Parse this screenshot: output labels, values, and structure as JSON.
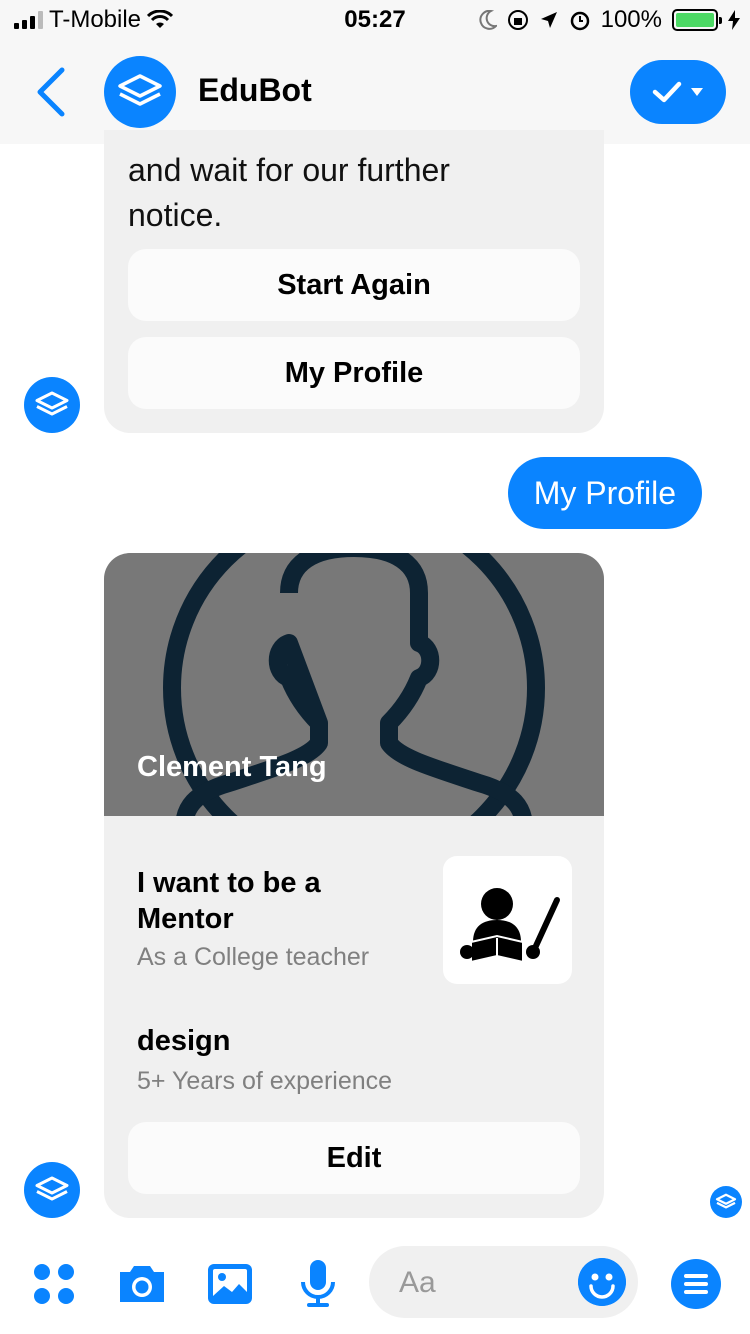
{
  "status_bar": {
    "carrier": "T-Mobile",
    "time": "05:27",
    "battery": "100%"
  },
  "header": {
    "title": "EduBot",
    "back_icon": "chevron-left-icon",
    "action_icon": "checkmark-icon"
  },
  "messages": {
    "bot_text": [
      "and wait for our further",
      "notice."
    ],
    "quick_replies": [
      "Start Again",
      "My Profile"
    ],
    "user_reply": "My Profile",
    "profile_card": {
      "name": "Clement Tang",
      "role_title": "I want to be a Mentor",
      "role_subtitle": "As a College teacher",
      "skill": "design",
      "skill_subtitle": "5+ Years of experience",
      "edit_button": "Edit"
    }
  },
  "composer": {
    "placeholder": "Aa",
    "icons": [
      "apps-icon",
      "camera-icon",
      "gallery-icon",
      "microphone-icon",
      "emoji-icon",
      "menu-icon"
    ]
  },
  "colors": {
    "accent": "#0a84ff",
    "bubble_bg": "#f0f0f0",
    "hero_bg": "#787878"
  }
}
